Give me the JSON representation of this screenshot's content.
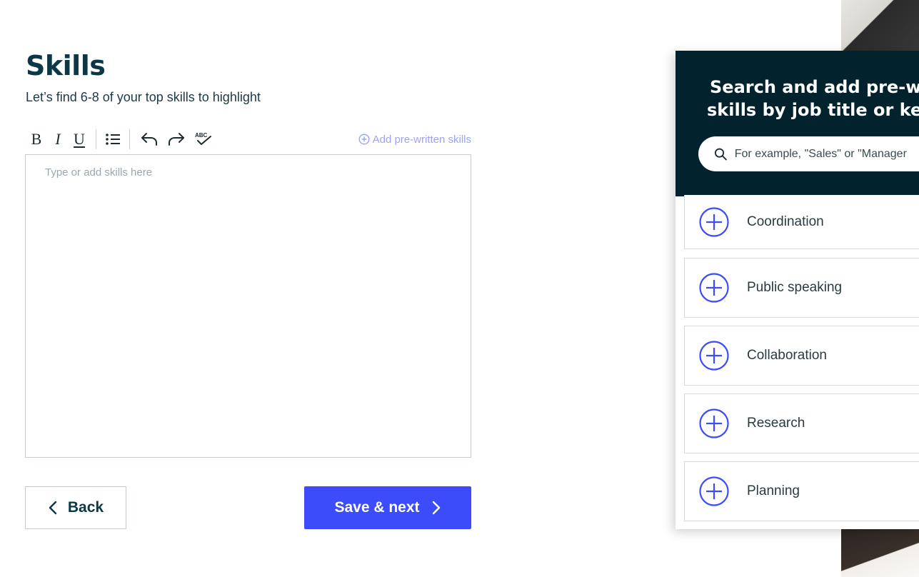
{
  "page": {
    "title": "Skills",
    "subtitle": "Let’s find 6-8 of your top skills to highlight"
  },
  "toolbar": {
    "bold": "B",
    "italic": "I",
    "underline": "U",
    "add_prewritten_label": "Add pre-written skills"
  },
  "editor": {
    "placeholder": "Type or add skills here",
    "value": ""
  },
  "nav": {
    "back_label": "Back",
    "save_label": "Save & next"
  },
  "panel": {
    "title_line1": "Search and add pre-wr",
    "title_line2": "skills by job title or key",
    "search_placeholder": "For example, \"Sales\" or \"Manager",
    "skills": [
      {
        "label": "Coordination"
      },
      {
        "label": "Public speaking"
      },
      {
        "label": "Collaboration"
      },
      {
        "label": "Research"
      },
      {
        "label": "Planning"
      }
    ]
  },
  "colors": {
    "primary": "#3d4cfa",
    "heading": "#0b3844",
    "panel_header": "#02232e",
    "prewritten_link": "#9aa3f5"
  }
}
